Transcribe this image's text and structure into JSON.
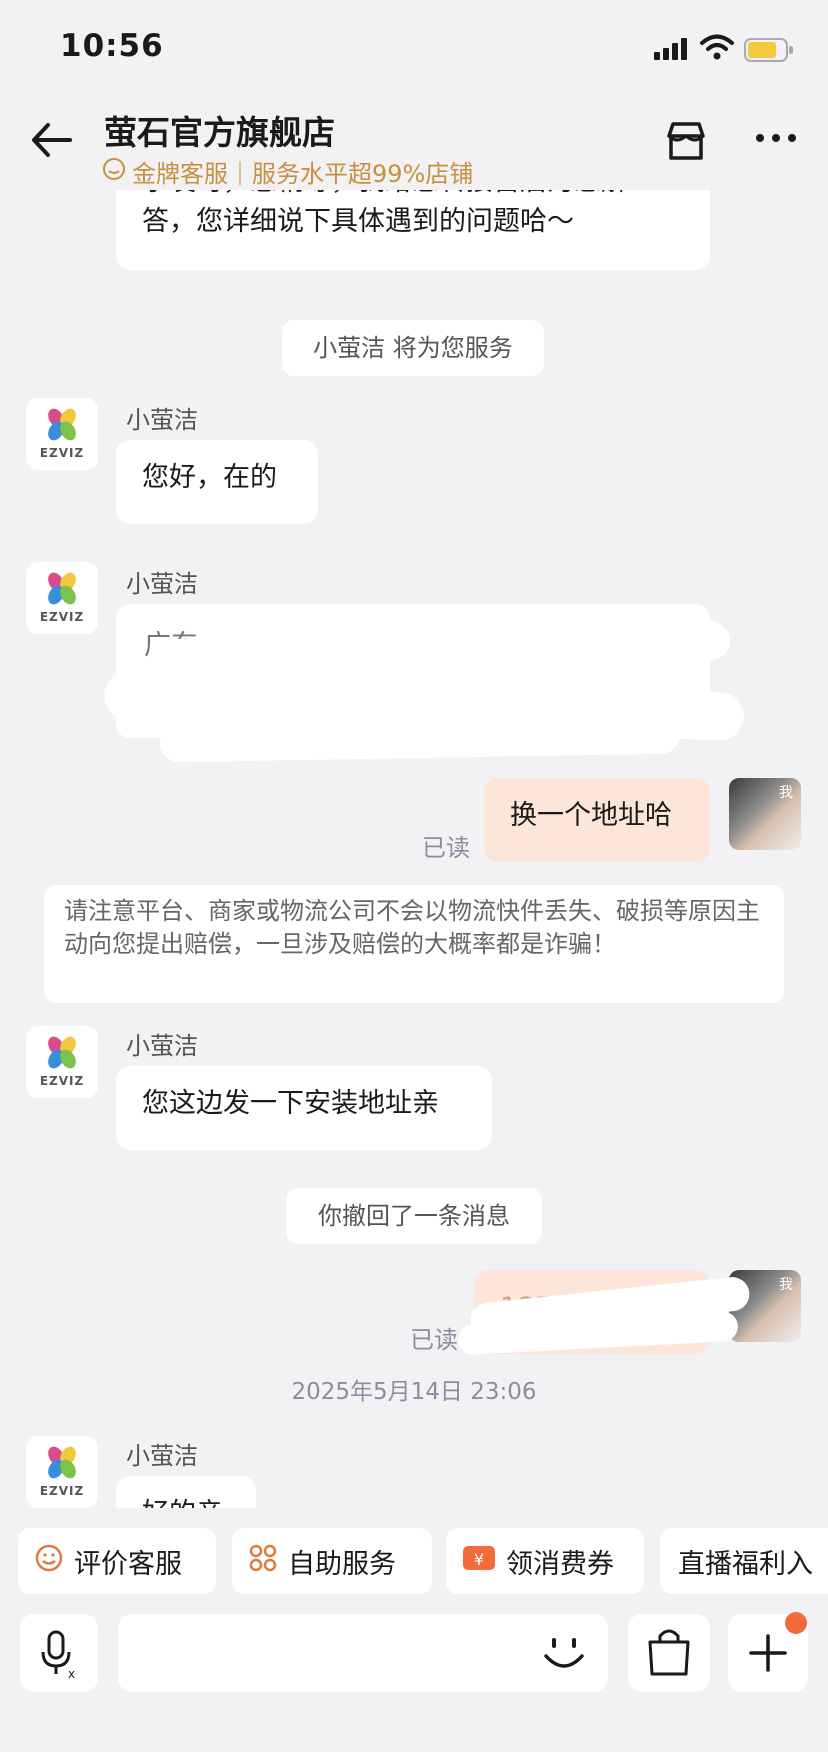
{
  "status_bar": {
    "time": "10:56"
  },
  "header": {
    "title": "萤石官方旗舰店",
    "subtitle": "金牌客服｜服务水平超99%店铺"
  },
  "chat": {
    "partial_message_line1": "求发时，您稍等，我给您转接售后为您解",
    "partial_message_line2": "答，您详细说下具体遇到的问题哈～",
    "system_service": "小萤洁 将为您服务",
    "agent_name": "小萤洁",
    "brand": "EZVIZ",
    "msg_hello": "您好，在的",
    "redacted_fragment_1": "广东",
    "redacted_fragment_2": "1",
    "my_msg_change_address": "换一个地址哈",
    "read_label": "已读",
    "me_label": "我",
    "warning": "请注意平台、商家或物流公司不会以物流快件丢失、破损等原因主动向您提出赔偿，一旦涉及赔偿的大概率都是诈骗！",
    "msg_send_address": "您这边发一下安装地址亲",
    "system_recall": "你撤回了一条消息",
    "my_redacted_fragment": "185",
    "timestamp": "2025年5月14日 23:06",
    "partial_last_message": "好的亲"
  },
  "quick_actions": [
    {
      "label": "评价客服",
      "icon": "smiley-icon"
    },
    {
      "label": "自助服务",
      "icon": "grid-icon"
    },
    {
      "label": "领消费券",
      "icon": "coupon-icon"
    },
    {
      "label": "直播福利入",
      "icon": ""
    }
  ],
  "input_bar": {
    "voice_icon": "microphone-icon",
    "emoji_icon": "smiley-icon",
    "cart_icon": "shopping-bag-icon",
    "plus_icon": "plus-icon"
  },
  "colors": {
    "accent_gold": "#c6913e",
    "my_bubble": "#fbe6d9",
    "badge_dot": "#f26b3a"
  }
}
